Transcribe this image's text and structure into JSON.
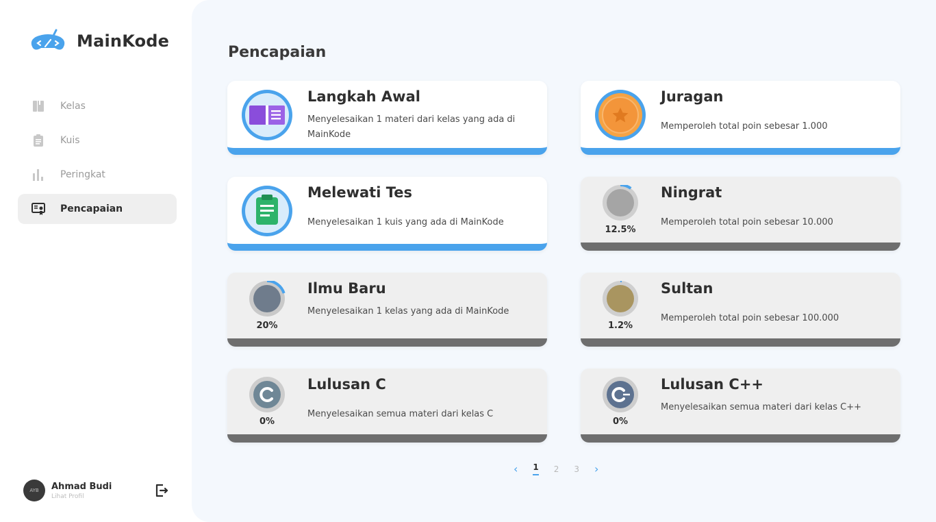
{
  "app": {
    "name": "MainKode"
  },
  "sidebar": {
    "items": [
      {
        "label": "Kelas",
        "icon": "book-icon",
        "active": false
      },
      {
        "label": "Kuis",
        "icon": "clipboard-icon",
        "active": false
      },
      {
        "label": "Peringkat",
        "icon": "bar-chart-icon",
        "active": false
      },
      {
        "label": "Pencapaian",
        "icon": "certificate-icon",
        "active": true
      }
    ]
  },
  "profile": {
    "name": "Ahmad Budi",
    "link": "Lihat Profil",
    "avatar_text": "AYB"
  },
  "main": {
    "title": "Pencapaian",
    "achievements": [
      {
        "title": "Langkah Awal",
        "desc": "Menyelesaikan 1 materi dari kelas yang ada di MainKode",
        "status": "done",
        "icon": "book-badge-icon"
      },
      {
        "title": "Juragan",
        "desc": "Memperoleh total poin sebesar 1.000",
        "status": "done",
        "icon": "star-medal-icon"
      },
      {
        "title": "Melewati Tes",
        "desc": "Menyelesaikan 1 kuis yang ada di MainKode",
        "status": "done",
        "icon": "clipboard-badge-icon"
      },
      {
        "title": "Ningrat",
        "desc": "Memperoleh total poin sebesar 10.000",
        "status": "locked",
        "progress": "12.5%",
        "icon": "medal-icon"
      },
      {
        "title": "Ilmu Baru",
        "desc": "Menyelesaikan 1 kelas yang ada di MainKode",
        "status": "locked",
        "progress": "20%",
        "icon": "book-badge-icon"
      },
      {
        "title": "Sultan",
        "desc": "Memperoleh total poin sebesar 100.000",
        "status": "locked",
        "progress": "1.2%",
        "icon": "medal-icon"
      },
      {
        "title": "Lulusan C",
        "desc": "Menyelesaikan semua materi dari kelas C",
        "status": "locked",
        "progress": "0%",
        "icon": "c-language-icon"
      },
      {
        "title": "Lulusan C++",
        "desc": "Menyelesaikan semua materi dari kelas C++",
        "status": "locked",
        "progress": "0%",
        "icon": "cpp-language-icon"
      }
    ]
  },
  "pagination": {
    "pages": [
      "1",
      "2",
      "3"
    ],
    "current": "1",
    "prev": "‹",
    "next": "›"
  },
  "colors": {
    "accent": "#4aa3ec",
    "locked": "#6e6e6e",
    "background": "#f4f8fd"
  }
}
